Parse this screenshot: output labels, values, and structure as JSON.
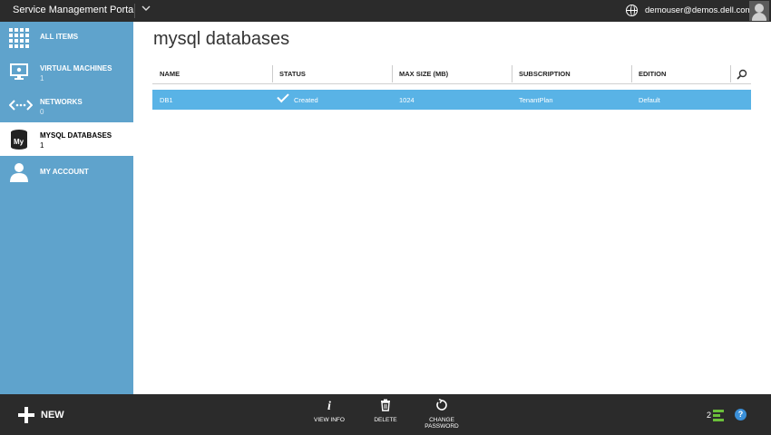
{
  "header": {
    "brand": "Service Management Portal",
    "menu_icon": "chevron-down-icon",
    "globe_icon": "globe-icon",
    "user": "demouser@demos.dell.com",
    "avatar_icon": "user-avatar-icon"
  },
  "sidebar": {
    "items": [
      {
        "label": "ALL ITEMS",
        "count": "",
        "icon": "grid-icon"
      },
      {
        "label": "VIRTUAL MACHINES",
        "count": "1",
        "icon": "monitor-icon"
      },
      {
        "label": "NETWORKS",
        "count": "0",
        "icon": "network-icon"
      },
      {
        "label": "MYSQL DATABASES",
        "count": "1",
        "icon": "mysql-database-icon"
      },
      {
        "label": "MY ACCOUNT",
        "count": "",
        "icon": "person-icon"
      }
    ],
    "active_index": 3,
    "color": "#5fa3cc"
  },
  "main": {
    "title": "mysql databases",
    "table": {
      "columns": [
        "NAME",
        "STATUS",
        "MAX SIZE (MB)",
        "SUBSCRIPTION",
        "EDITION"
      ],
      "rows": [
        {
          "name": "DB1",
          "status": "Created",
          "max_size": "1024",
          "subscription": "TenantPlan",
          "edition": "Default",
          "selected": true
        }
      ],
      "selected_row_color": "#59b3e6"
    }
  },
  "commandbar": {
    "new_label": "NEW",
    "commands": [
      {
        "label": "VIEW INFO",
        "icon": "info-icon"
      },
      {
        "label": "DELETE",
        "icon": "trash-icon"
      },
      {
        "label": "CHANGE\nPASSWORD",
        "icon": "refresh-icon"
      }
    ],
    "notifications_count": "2",
    "help_label": "?"
  }
}
